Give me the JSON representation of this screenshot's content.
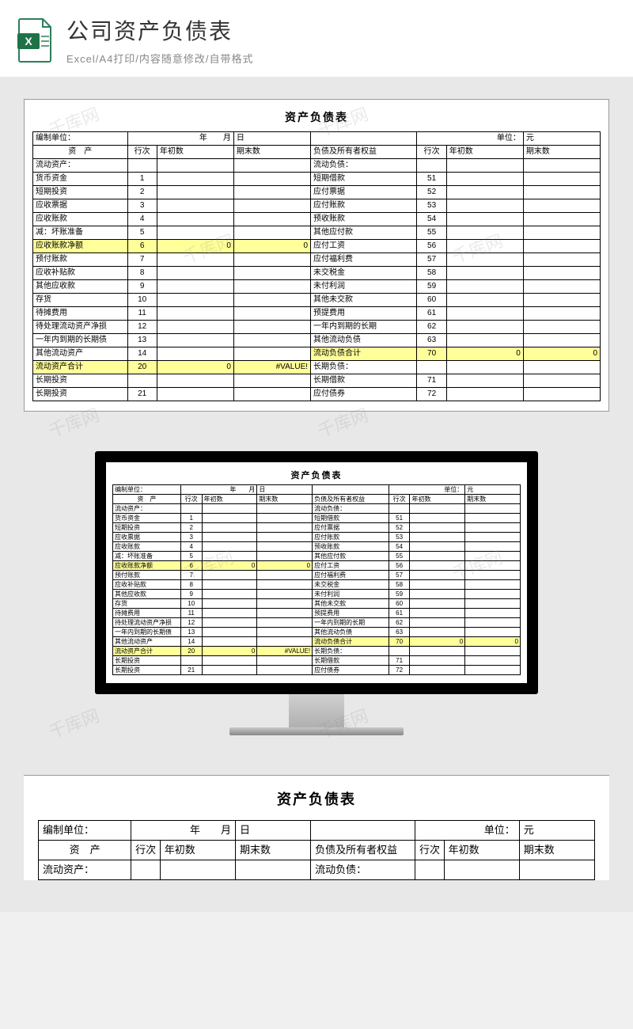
{
  "header": {
    "title": "公司资产负债表",
    "subtitle": "Excel/A4打印/内容随意修改/自带格式"
  },
  "sheet": {
    "title": "资产负债表",
    "meta": {
      "org_label": "编制单位：",
      "year_label": "年",
      "month_label": "月",
      "day_label": "日",
      "unit_label": "单位：",
      "unit_value": "元"
    },
    "cols": {
      "left_name": "资　产",
      "row_no": "行次",
      "begin": "年初数",
      "end": "期末数",
      "right_name": "负债及所有者权益",
      "right_row_no": "行次",
      "right_begin": "年初数",
      "right_end": "期末数"
    },
    "rows": [
      {
        "l": "流动资产：",
        "ln": "",
        "r": "流动负债：",
        "rn": ""
      },
      {
        "l": "货币资金",
        "ln": "1",
        "r": "短期借款",
        "rn": "51",
        "li": 1,
        "ri": 1
      },
      {
        "l": "短期投资",
        "ln": "2",
        "r": "应付票据",
        "rn": "52",
        "li": 1,
        "ri": 1
      },
      {
        "l": "应收票据",
        "ln": "3",
        "r": "应付账款",
        "rn": "53",
        "li": 1,
        "ri": 1
      },
      {
        "l": "应收账款",
        "ln": "4",
        "r": "预收账款",
        "rn": "54",
        "li": 1,
        "ri": 1
      },
      {
        "l": "减：坏账准备",
        "ln": "5",
        "r": "其他应付款",
        "rn": "55",
        "li": 2,
        "ri": 1
      },
      {
        "l": "应收账款净额",
        "ln": "6",
        "lb": "0",
        "le": "0",
        "r": "应付工资",
        "rn": "56",
        "li": 1,
        "ri": 1,
        "hl": "l"
      },
      {
        "l": "预付账款",
        "ln": "7",
        "r": "应付福利费",
        "rn": "57",
        "li": 1,
        "ri": 1
      },
      {
        "l": "应收补贴款",
        "ln": "8",
        "r": "未交税金",
        "rn": "58",
        "li": 1,
        "ri": 1
      },
      {
        "l": "其他应收款",
        "ln": "9",
        "r": "未付利润",
        "rn": "59",
        "li": 1,
        "ri": 1
      },
      {
        "l": "存货",
        "ln": "10",
        "r": "其他未交款",
        "rn": "60",
        "li": 1,
        "ri": 1
      },
      {
        "l": "待摊费用",
        "ln": "11",
        "r": "预提费用",
        "rn": "61",
        "li": 1,
        "ri": 1
      },
      {
        "l": "待处理流动资产净损",
        "ln": "12",
        "r": "一年内到期的长期",
        "rn": "62",
        "li": 1,
        "ri": 1
      },
      {
        "l": "一年内到期的长期债",
        "ln": "13",
        "r": "其他流动负债",
        "rn": "63",
        "li": 1,
        "ri": 1
      },
      {
        "l": "其他流动资产",
        "ln": "14",
        "r": "流动负债合计",
        "rn": "70",
        "rb": "0",
        "re": "0",
        "li": 1,
        "ri": 2,
        "hl": "r"
      },
      {
        "l": "流动资产合计",
        "ln": "20",
        "lb": "0",
        "le": "#VALUE!",
        "r": "长期负债：",
        "rn": "",
        "li": 2,
        "hl": "l"
      },
      {
        "l": "长期投资",
        "ln": "",
        "r": "长期借款",
        "rn": "71",
        "ri": 1
      },
      {
        "l": "长期投资",
        "ln": "21",
        "r": "应付债券",
        "rn": "72",
        "li": 1,
        "ri": 1
      }
    ]
  },
  "watermark": "千库网"
}
